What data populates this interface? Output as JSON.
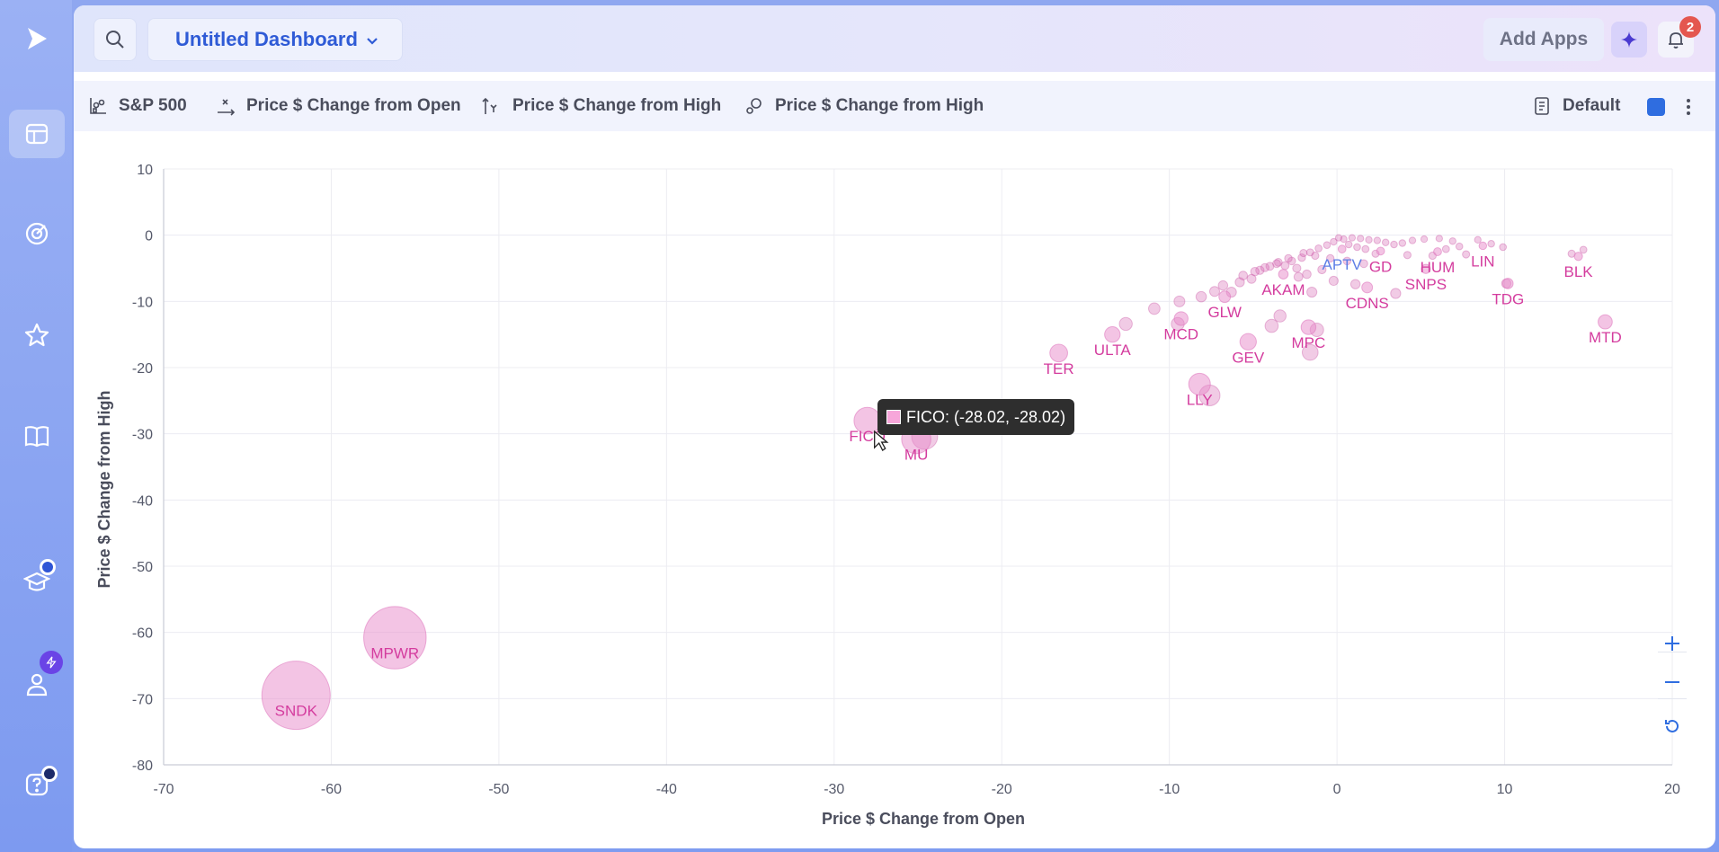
{
  "app": {
    "dashboard_title": "Untitled Dashboard",
    "add_apps_label": "Add Apps",
    "notification_count": "2"
  },
  "rail": {
    "items": [
      {
        "name": "logo-icon"
      },
      {
        "name": "dashboard-icon",
        "active": true
      },
      {
        "name": "radar-icon"
      },
      {
        "name": "star-icon"
      },
      {
        "name": "book-icon"
      },
      {
        "name": "graduation-cap-icon"
      },
      {
        "name": "user-icon"
      },
      {
        "name": "help-icon"
      }
    ]
  },
  "toolbar": {
    "dataset_label": "S&P 500",
    "x_field_label": "Price $ Change from Open",
    "y_field_label": "Price $ Change from High",
    "size_field_label": "Price $ Change from High",
    "theme_label": "Default",
    "series_color": "#2f6de0"
  },
  "tooltip": {
    "text": "FICO: (-28.02, -28.02)"
  },
  "chart_data": {
    "type": "scatter",
    "xlabel": "Price $ Change from Open",
    "ylabel": "Price $ Change from High",
    "xlim": [
      -70,
      20
    ],
    "ylim": [
      -80,
      10
    ],
    "xticks": [
      -70,
      -60,
      -50,
      -40,
      -30,
      -20,
      -10,
      0,
      10,
      20
    ],
    "yticks": [
      10,
      0,
      -10,
      -20,
      -30,
      -40,
      -50,
      -60,
      -70,
      -80
    ],
    "grid": true,
    "point_color": "#e889c9",
    "labeled_points": [
      {
        "label": "SNDK",
        "x": -62.1,
        "y": -69.5
      },
      {
        "label": "MPWR",
        "x": -56.2,
        "y": -60.8
      },
      {
        "label": "FICO",
        "x": -28.02,
        "y": -28.02
      },
      {
        "label": "MU",
        "x": -25.1,
        "y": -30.8
      },
      {
        "label": "TER",
        "x": -16.6,
        "y": -17.8
      },
      {
        "label": "ULTA",
        "x": -13.4,
        "y": -15.0
      },
      {
        "label": "MCD",
        "x": -9.3,
        "y": -12.6
      },
      {
        "label": "LLY",
        "x": -8.2,
        "y": -22.5
      },
      {
        "label": "GLW",
        "x": -6.7,
        "y": -9.3
      },
      {
        "label": "GEV",
        "x": -5.3,
        "y": -16.1
      },
      {
        "label": "AKAM",
        "x": -3.2,
        "y": -5.9
      },
      {
        "label": "MPC",
        "x": -1.7,
        "y": -13.9
      },
      {
        "label": "APTV",
        "x": 0.3,
        "y": -2.1
      },
      {
        "label": "GD",
        "x": 2.6,
        "y": -2.4
      },
      {
        "label": "CDNS",
        "x": 1.8,
        "y": -7.9
      },
      {
        "label": "HUM",
        "x": 6.0,
        "y": -2.5
      },
      {
        "label": "SNPS",
        "x": 5.3,
        "y": -5.1
      },
      {
        "label": "LIN",
        "x": 8.7,
        "y": -1.6
      },
      {
        "label": "TDG",
        "x": 10.2,
        "y": -7.3
      },
      {
        "label": "BLK",
        "x": 14.4,
        "y": -3.2
      },
      {
        "label": "MTD",
        "x": 16.0,
        "y": -13.1
      }
    ],
    "unlabeled_points": [
      {
        "x": -24.6,
        "y": -30.4
      },
      {
        "x": -7.6,
        "y": -24.2
      },
      {
        "x": -10.9,
        "y": -11.1
      },
      {
        "x": -12.6,
        "y": -13.4
      },
      {
        "x": -9.5,
        "y": -13.4
      },
      {
        "x": -1.6,
        "y": -17.7
      },
      {
        "x": -3.9,
        "y": -13.7
      },
      {
        "x": -3.4,
        "y": -12.2
      },
      {
        "x": -1.2,
        "y": -14.3
      },
      {
        "x": -9.4,
        "y": -10.0
      },
      {
        "x": -8.1,
        "y": -9.3
      },
      {
        "x": -6.3,
        "y": -8.6
      },
      {
        "x": -5.8,
        "y": -7.1
      },
      {
        "x": -5.1,
        "y": -6.6
      },
      {
        "x": -4.6,
        "y": -5.3
      },
      {
        "x": -4.0,
        "y": -4.7
      },
      {
        "x": -3.5,
        "y": -4.1
      },
      {
        "x": -2.7,
        "y": -3.9
      },
      {
        "x": -2.1,
        "y": -3.4
      },
      {
        "x": -1.6,
        "y": -2.6
      },
      {
        "x": -1.1,
        "y": -2.0
      },
      {
        "x": -0.6,
        "y": -1.5
      },
      {
        "x": -0.2,
        "y": -1.0
      },
      {
        "x": 0.4,
        "y": -0.6
      },
      {
        "x": 0.9,
        "y": -0.4
      },
      {
        "x": 1.4,
        "y": -0.5
      },
      {
        "x": 1.9,
        "y": -0.7
      },
      {
        "x": 2.4,
        "y": -0.8
      },
      {
        "x": 2.9,
        "y": -1.1
      },
      {
        "x": 3.4,
        "y": -1.4
      },
      {
        "x": 3.9,
        "y": -1.2
      },
      {
        "x": 4.5,
        "y": -0.8
      },
      {
        "x": 5.2,
        "y": -0.6
      },
      {
        "x": 6.1,
        "y": -0.5
      },
      {
        "x": 6.9,
        "y": -0.9
      },
      {
        "x": 7.7,
        "y": -2.9
      },
      {
        "x": 8.4,
        "y": -0.7
      },
      {
        "x": 9.2,
        "y": -1.3
      },
      {
        "x": 9.9,
        "y": -1.8
      },
      {
        "x": 14.0,
        "y": -2.8
      },
      {
        "x": 14.7,
        "y": -2.2
      },
      {
        "x": 10.1,
        "y": -7.3
      },
      {
        "x": 3.5,
        "y": -8.8
      },
      {
        "x": 1.1,
        "y": -7.4
      },
      {
        "x": -0.2,
        "y": -6.9
      },
      {
        "x": -0.9,
        "y": -5.2
      },
      {
        "x": -1.8,
        "y": -5.9
      },
      {
        "x": -2.4,
        "y": -5.0
      },
      {
        "x": -3.6,
        "y": -4.3
      },
      {
        "x": -4.3,
        "y": -4.9
      },
      {
        "x": -5.6,
        "y": -6.1
      },
      {
        "x": -6.8,
        "y": -7.6
      },
      {
        "x": -7.3,
        "y": -8.5
      },
      {
        "x": -0.4,
        "y": -3.5
      },
      {
        "x": 0.6,
        "y": -3.9
      },
      {
        "x": 1.6,
        "y": -4.3
      },
      {
        "x": 2.3,
        "y": -2.8
      },
      {
        "x": 4.2,
        "y": -3.0
      },
      {
        "x": 5.7,
        "y": -3.1
      },
      {
        "x": 6.5,
        "y": -2.1
      },
      {
        "x": 7.3,
        "y": -1.7
      },
      {
        "x": 0.1,
        "y": -0.4
      },
      {
        "x": 0.7,
        "y": -1.4
      },
      {
        "x": 1.2,
        "y": -1.8
      },
      {
        "x": 1.7,
        "y": -2.1
      },
      {
        "x": -1.3,
        "y": -3.1
      },
      {
        "x": -2.0,
        "y": -2.7
      },
      {
        "x": -2.9,
        "y": -3.5
      },
      {
        "x": -3.1,
        "y": -4.6
      },
      {
        "x": -4.9,
        "y": -5.5
      },
      {
        "x": -2.3,
        "y": -6.3
      },
      {
        "x": -1.5,
        "y": -8.6
      }
    ]
  }
}
